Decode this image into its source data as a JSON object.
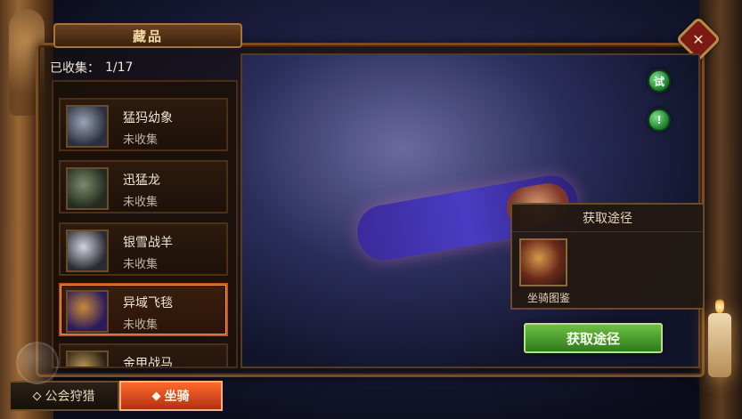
{
  "window": {
    "title": "藏品"
  },
  "summary": {
    "collected_label": "已收集：",
    "collected_value": "1/17"
  },
  "list": {
    "items": [
      {
        "name": "猛犸幼象",
        "status": "未收集"
      },
      {
        "name": "迅猛龙",
        "status": "未收集"
      },
      {
        "name": "银雪战羊",
        "status": "未收集"
      },
      {
        "name": "异域飞毯",
        "status": "未收集",
        "selected": true
      },
      {
        "name": "金甲战马",
        "status": ""
      }
    ]
  },
  "preview": {
    "side_buttons": {
      "try_label": "试",
      "info_label": "!"
    }
  },
  "acquire_popup": {
    "title": "获取途径",
    "item_label": "坐骑图鉴"
  },
  "actions": {
    "acquire_button_label": "获取途径"
  },
  "tabs": [
    {
      "label": "公会狩猎",
      "active": false
    },
    {
      "label": "坐骑",
      "active": true
    }
  ],
  "colors": {
    "accent": "#ff6a2b",
    "success": "#2f7a1b",
    "frame": "#7b4b22"
  }
}
